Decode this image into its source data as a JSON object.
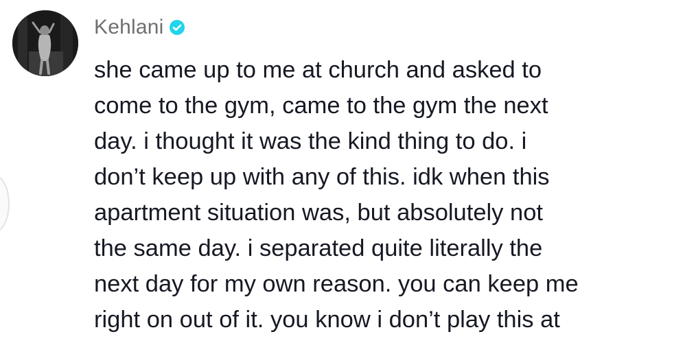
{
  "comment": {
    "username": "Kehlani",
    "verified": true,
    "verified_color": "#20D5EC",
    "avatar_icon": "profile-photo",
    "text_lines": [
      "she came up to me at church and asked to",
      "come to the gym, came to the gym the next",
      "day. i thought it was the kind thing to do. i",
      "don’t keep up with any of this. idk when this",
      "apartment situation was, but absolutely not",
      "the same day. i separated quite literally the",
      "next day for my own reason. you can keep me",
      "right on out of it. you know i don’t play this at"
    ]
  }
}
